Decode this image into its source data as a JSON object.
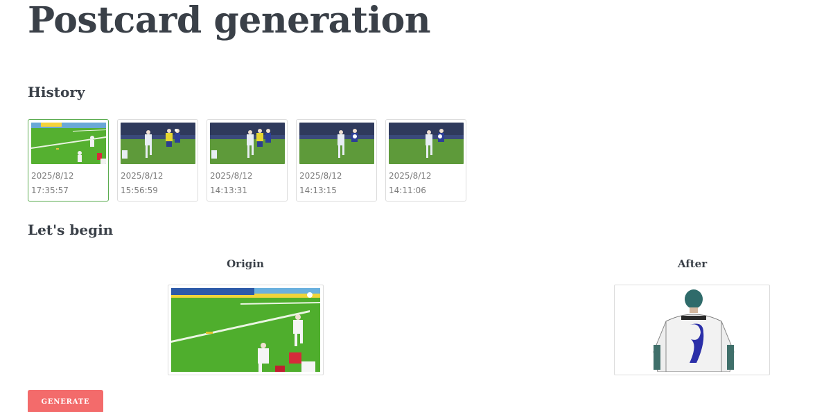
{
  "page": {
    "title": "Postcard generation"
  },
  "history": {
    "title": "History",
    "items": [
      {
        "date": "2025/8/12",
        "time": "17:35:57",
        "selected": true
      },
      {
        "date": "2025/8/12",
        "time": "15:56:59",
        "selected": false
      },
      {
        "date": "2025/8/12",
        "time": "14:13:31",
        "selected": false
      },
      {
        "date": "2025/8/12",
        "time": "14:13:15",
        "selected": false
      },
      {
        "date": "2025/8/12",
        "time": "14:11:06",
        "selected": false
      }
    ]
  },
  "begin": {
    "title": "Let's begin",
    "origin_label": "Origin",
    "after_label": "After"
  },
  "actions": {
    "generate_label": "GENERATE"
  },
  "colors": {
    "accent": "#f36b6b",
    "selected_border": "#5aab4e",
    "pitch": "#4fae2d"
  }
}
